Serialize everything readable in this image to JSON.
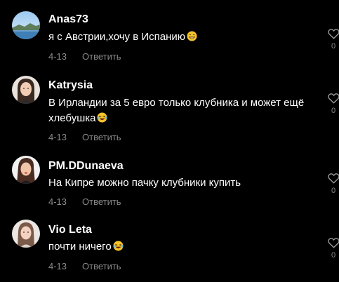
{
  "comments": [
    {
      "username": "Anas73",
      "text": "я с Австрии,хочу в Испанию",
      "emoji": "😁",
      "date": "4-13",
      "reply_label": "Ответить",
      "likes": "0"
    },
    {
      "username": "Katrysia",
      "text": "В Ирландии за 5 евро только клубника и может ещё хлебушка",
      "emoji": "😂",
      "date": "4-13",
      "reply_label": "Ответить",
      "likes": "0"
    },
    {
      "username": "PM.DDunaeva",
      "text": "На Кипре можно пачку клубники купить",
      "emoji": "",
      "date": "4-13",
      "reply_label": "Ответить",
      "likes": "0"
    },
    {
      "username": "Vio Leta",
      "text": "почти ничего",
      "emoji": "😂",
      "date": "4-13",
      "reply_label": "Ответить",
      "likes": "0"
    }
  ]
}
